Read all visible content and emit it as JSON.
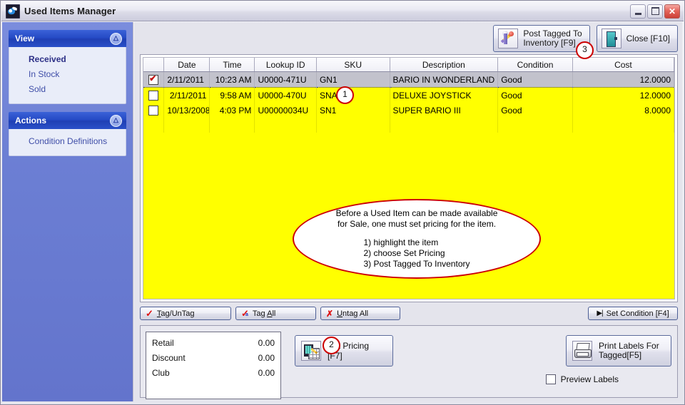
{
  "window": {
    "title": "Used Items Manager",
    "icon": "app-swoosh-icon",
    "minimize": "−",
    "maximize": "□",
    "close": "✕"
  },
  "sidebar": {
    "panels": [
      {
        "title": "View",
        "collapse_icon": "chevron-up-icon",
        "items": [
          {
            "label": "Received",
            "active": true
          },
          {
            "label": "In Stock",
            "active": false
          },
          {
            "label": "Sold",
            "active": false
          }
        ]
      },
      {
        "title": "Actions",
        "collapse_icon": "chevron-up-icon",
        "items": [
          {
            "label": "Condition Definitions",
            "active": false
          }
        ]
      }
    ]
  },
  "toolbar": {
    "post_tagged_label": "Post Tagged To\nInventory [F9]",
    "post_tagged_icon": "pencil-icon",
    "close_label": "Close [F10]",
    "close_icon": "exit-door-icon"
  },
  "grid": {
    "columns": [
      "",
      "Date",
      "Time",
      "Lookup ID",
      "SKU",
      "Description",
      "Condition",
      "Cost"
    ],
    "rows": [
      {
        "checked": true,
        "selected": true,
        "date": "2/11/2011",
        "time": "10:23 AM",
        "lookup_id": "U0000-471U",
        "sku": "GN1",
        "description": "BARIO IN WONDERLAND",
        "condition": "Good",
        "cost": "12.0000"
      },
      {
        "checked": false,
        "selected": false,
        "date": "2/11/2011",
        "time": "9:58 AM",
        "lookup_id": "U0000-470U",
        "sku": "SNA1",
        "description": "DELUXE JOYSTICK",
        "condition": "Good",
        "cost": "12.0000"
      },
      {
        "checked": false,
        "selected": false,
        "date": "10/13/2008",
        "time": "4:03 PM",
        "lookup_id": "U00000034U",
        "sku": "SN1",
        "description": "SUPER BARIO III",
        "condition": "Good",
        "cost": "8.0000"
      }
    ]
  },
  "callout": {
    "line1": "Before a Used Item can be made available",
    "line2": "for Sale, one must set pricing for the item.",
    "step1": "1)  highlight the item",
    "step2": "2) choose Set Pricing",
    "step3": "3) Post Tagged To Inventory"
  },
  "markers": {
    "one": "1",
    "two": "2",
    "three": "3"
  },
  "grid_buttons": {
    "tag_untag": "Tag/UnTag",
    "tag_all": "Tag All",
    "untag_all": "Untag All",
    "set_condition": "Set Condition [F4]",
    "tag_icon": "red-check-icon",
    "untag_icon": "red-x-icon",
    "set_condition_icon": "skip-to-end-icon"
  },
  "totals": {
    "rows": [
      {
        "label": "Retail",
        "value": "0.00"
      },
      {
        "label": "Discount",
        "value": "0.00"
      },
      {
        "label": "Club",
        "value": "0.00"
      }
    ]
  },
  "actions": {
    "set_pricing_label": "Set Pricing [F7]",
    "set_pricing_icon": "calculator-spreadsheet-icon",
    "print_labels_label": "Print Labels For\nTagged[F5]",
    "print_labels_icon": "printer-icon",
    "preview_labels_label": "Preview Labels",
    "preview_labels_checked": false
  },
  "colors": {
    "grid_background": "#ffff00",
    "selected_row": "#c2c2cc",
    "sidebar": "#6c7fd4",
    "panel_header": "#2449c4",
    "marker_red": "#cc0000"
  }
}
